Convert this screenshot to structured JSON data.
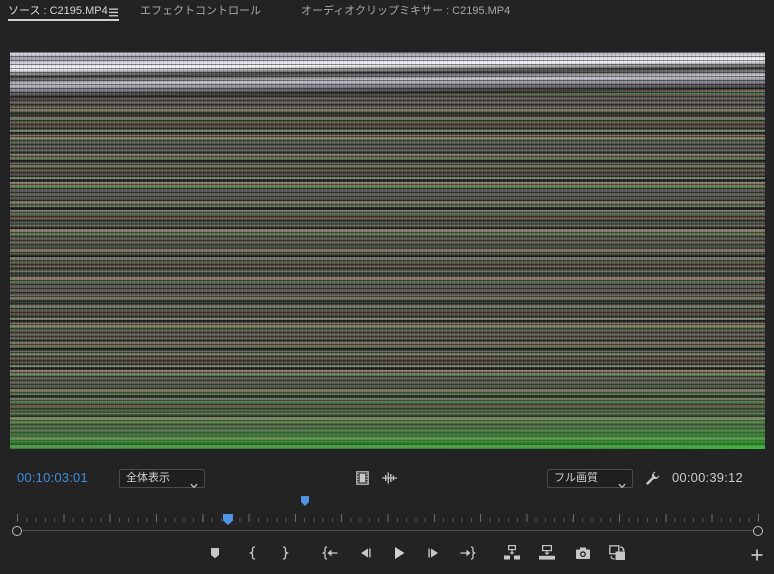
{
  "tabs": [
    {
      "label": "ソース : C2195.MP4",
      "active": true
    },
    {
      "label": "エフェクトコントロール",
      "active": false
    },
    {
      "label": "オーディオクリップミキサー : C2195.MP4",
      "active": false
    }
  ],
  "tab_menu_icon": "hamburger-menu-icon",
  "source_monitor": {
    "current_timecode": "00:10:03:01",
    "zoom_level": "全体表示",
    "playback_resolution": "フル画質",
    "duration_timecode": "00:00:39:12",
    "playhead_progress": 0.285,
    "navigator_marker_progress": 0.389,
    "drag_video_icon": "film-strip-icon",
    "drag_audio_icon": "audio-waveform-icon",
    "settings_icon": "wrench-icon"
  },
  "transport": [
    {
      "name": "add-marker",
      "icon": "marker-icon"
    },
    {
      "name": "mark-in",
      "icon": "mark-in-icon"
    },
    {
      "name": "mark-out",
      "icon": "mark-out-icon"
    },
    {
      "name": "go-to-in",
      "icon": "go-to-in-icon"
    },
    {
      "name": "step-back",
      "icon": "step-back-icon"
    },
    {
      "name": "play-stop",
      "icon": "play-icon"
    },
    {
      "name": "step-forward",
      "icon": "step-forward-icon"
    },
    {
      "name": "go-to-out",
      "icon": "go-to-out-icon"
    },
    {
      "name": "insert",
      "icon": "insert-icon"
    },
    {
      "name": "overwrite",
      "icon": "overwrite-icon"
    },
    {
      "name": "export-frame",
      "icon": "camera-icon"
    },
    {
      "name": "toggle-proxies",
      "icon": "toggle-proxies-icon"
    },
    {
      "name": "button-editor",
      "icon": "plus-icon"
    }
  ],
  "colors": {
    "background": "#232323",
    "accent": "#3b8fdf",
    "text": "#bdbdbd"
  }
}
